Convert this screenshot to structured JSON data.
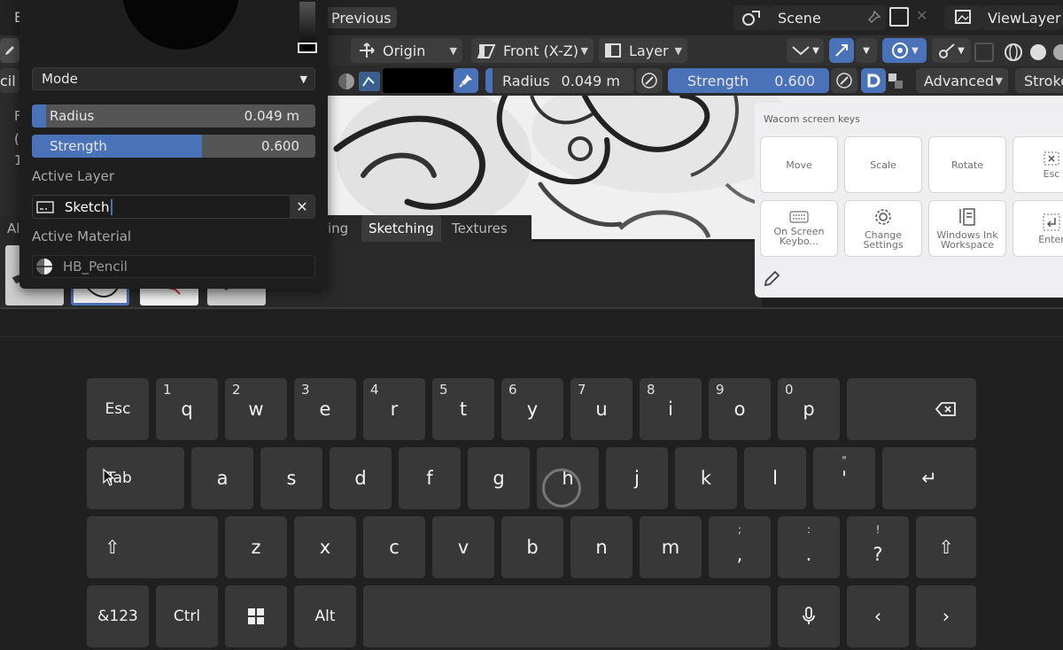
{
  "header": {
    "previous_label": "Previous",
    "scene_label": "Scene",
    "viewlayer_label": "ViewLayer",
    "edge_letter": "E"
  },
  "toolbar": {
    "pivot_label": "Origin",
    "view_label": "Front (X-Z)",
    "layer_label": "Layer",
    "mode_left_text": "cil",
    "radius_label": "Radius",
    "radius_value": "0.049 m",
    "strength_label": "Strength",
    "strength_value": "0.600",
    "advanced_label": "Advanced",
    "stroke_label": "Stroke"
  },
  "popover": {
    "mode_label": "Mode",
    "radius_label": "Radius",
    "radius_value": "0.049 m",
    "radius_fill": 0.05,
    "strength_label": "Strength",
    "strength_value": "0.600",
    "strength_fill": 0.6,
    "active_layer_heading": "Active Layer",
    "layer_name": "Sketch",
    "active_material_heading": "Active Material",
    "material_name": "HB_Pencil"
  },
  "side_text": [
    "F",
    "(",
    "1"
  ],
  "tabs": [
    {
      "label": "Al"
    },
    {
      "label": "ing"
    },
    {
      "label": "Sketching"
    },
    {
      "label": "Textures"
    }
  ],
  "wacom": {
    "title": "Wacom screen keys",
    "keys": [
      {
        "label": "Move"
      },
      {
        "label": "Scale"
      },
      {
        "label": "Rotate"
      },
      {
        "label": "Esc"
      },
      {
        "label": "On Screen Keybo..."
      },
      {
        "label": "Change Settings"
      },
      {
        "label": "Windows Ink Workspace"
      },
      {
        "label": "Enter"
      }
    ]
  },
  "keyboard": {
    "row1": [
      {
        "main": "Esc",
        "sub": ""
      },
      {
        "main": "q",
        "sub": "1"
      },
      {
        "main": "w",
        "sub": "2"
      },
      {
        "main": "e",
        "sub": "3"
      },
      {
        "main": "r",
        "sub": "4"
      },
      {
        "main": "t",
        "sub": "5"
      },
      {
        "main": "y",
        "sub": "6"
      },
      {
        "main": "u",
        "sub": "7"
      },
      {
        "main": "i",
        "sub": "8"
      },
      {
        "main": "o",
        "sub": "9"
      },
      {
        "main": "p",
        "sub": "0"
      },
      {
        "main": "⌫",
        "sub": ""
      }
    ],
    "row2": [
      {
        "main": "Tab",
        "sub": ""
      },
      {
        "main": "a",
        "sub": ""
      },
      {
        "main": "s",
        "sub": ""
      },
      {
        "main": "d",
        "sub": ""
      },
      {
        "main": "f",
        "sub": ""
      },
      {
        "main": "g",
        "sub": ""
      },
      {
        "main": "h",
        "sub": ""
      },
      {
        "main": "j",
        "sub": ""
      },
      {
        "main": "k",
        "sub": ""
      },
      {
        "main": "l",
        "sub": ""
      },
      {
        "main": "'",
        "sub": "\""
      },
      {
        "main": "↵",
        "sub": ""
      }
    ],
    "row3": [
      {
        "main": "⇧",
        "sub": ""
      },
      {
        "main": "z",
        "sub": ""
      },
      {
        "main": "x",
        "sub": ""
      },
      {
        "main": "c",
        "sub": ""
      },
      {
        "main": "v",
        "sub": ""
      },
      {
        "main": "b",
        "sub": ""
      },
      {
        "main": "n",
        "sub": ""
      },
      {
        "main": "m",
        "sub": ""
      },
      {
        "main": ",",
        "sub": ";"
      },
      {
        "main": ".",
        "sub": ":"
      },
      {
        "main": "?",
        "sub": "!"
      },
      {
        "main": "⇧",
        "sub": ""
      }
    ],
    "row4": [
      {
        "main": "&123"
      },
      {
        "main": "Ctrl"
      },
      {
        "main": "⊞"
      },
      {
        "main": "Alt"
      },
      {
        "main": ""
      },
      {
        "main": "🎤"
      },
      {
        "main": "‹"
      },
      {
        "main": "›"
      }
    ]
  },
  "colors": {
    "accent_blue": "#4a72b8",
    "key_bg": "#383838",
    "keyboard_bg": "#202020"
  }
}
